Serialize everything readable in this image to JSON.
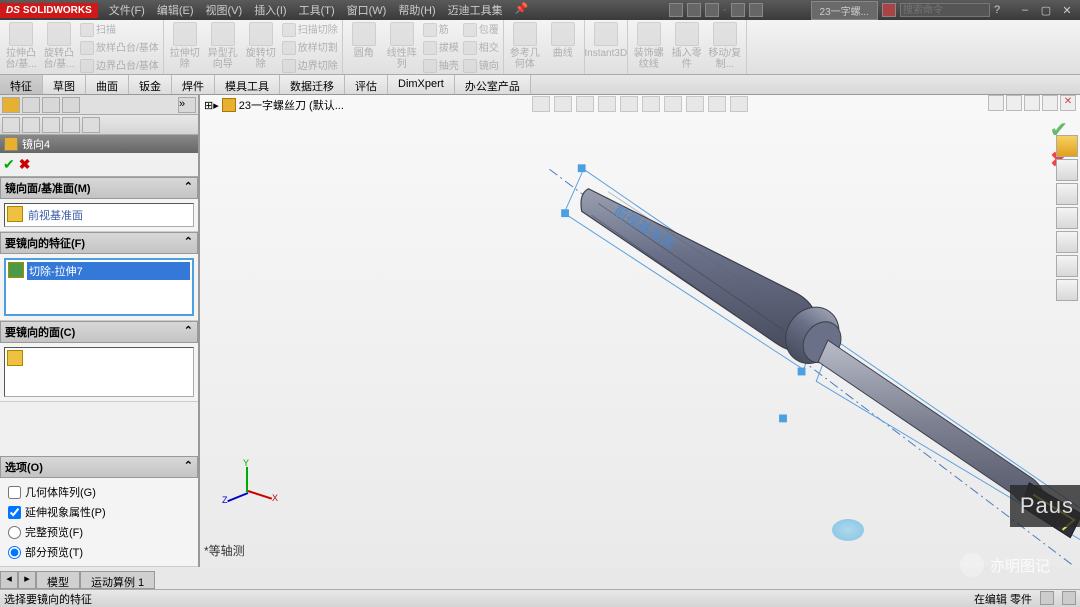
{
  "title": {
    "logo": "SOLIDWORKS"
  },
  "menus": [
    "文件(F)",
    "编辑(E)",
    "视图(V)",
    "插入(I)",
    "工具(T)",
    "窗口(W)",
    "帮助(H)",
    "迈迪工具集"
  ],
  "doc": {
    "name": "23一字螺...",
    "search": "搜索命令"
  },
  "ribbon": {
    "g1": [
      {
        "label": "拉伸凸台/基..."
      },
      {
        "label": "旋转凸台/基..."
      }
    ],
    "g1s": [
      "扫描",
      "放样凸台/基体",
      "边界凸台/基体"
    ],
    "g2": [
      {
        "label": "拉伸切除"
      },
      {
        "label": "异型孔向导"
      },
      {
        "label": "旋转切除"
      }
    ],
    "g2s": [
      "扫描切除",
      "放样切割",
      "边界切除"
    ],
    "g3": [
      {
        "label": "圆角"
      },
      {
        "label": "线性阵列"
      }
    ],
    "g3s": [
      "筋",
      "拔模",
      "抽壳"
    ],
    "g3s2": [
      "包覆",
      "相交",
      "镜向"
    ],
    "g4": [
      {
        "label": "参考几何体"
      },
      {
        "label": "曲线"
      }
    ],
    "g5": [
      {
        "label": "Instant3D"
      }
    ],
    "g6": [
      {
        "label": "装饰螺纹线"
      },
      {
        "label": "插入零件"
      },
      {
        "label": "移动/复制..."
      }
    ]
  },
  "tabs": [
    "特征",
    "草图",
    "曲面",
    "钣金",
    "焊件",
    "模具工具",
    "数据迁移",
    "评估",
    "DimXpert",
    "办公室产品"
  ],
  "breadcrumb": "23一字螺丝刀  (默认...",
  "feature": {
    "name": "镜向4",
    "sec1": {
      "title": "镜向面/基准面(M)",
      "value": "前视基准面"
    },
    "sec2": {
      "title": "要镜向的特征(F)",
      "value": "切除-拉伸7"
    },
    "sec3": {
      "title": "要镜向的面(C)"
    },
    "opts": {
      "title": "选项(O)",
      "o1": "几何体阵列(G)",
      "o2": "延伸视象属性(P)",
      "o3": "完整预览(F)",
      "o4": "部分预览(T)"
    }
  },
  "view": {
    "label": "*等轴测",
    "axes": {
      "x": "X",
      "y": "Y",
      "z": "Z"
    }
  },
  "bottomtabs": {
    "t1": "模型",
    "t2": "运动算例 1"
  },
  "status": {
    "left": "选择要镜向的特征",
    "r1": "在编辑 零件"
  },
  "overlay": {
    "paus": "Paus",
    "water": "亦明图记"
  },
  "annot": "前视基准面"
}
